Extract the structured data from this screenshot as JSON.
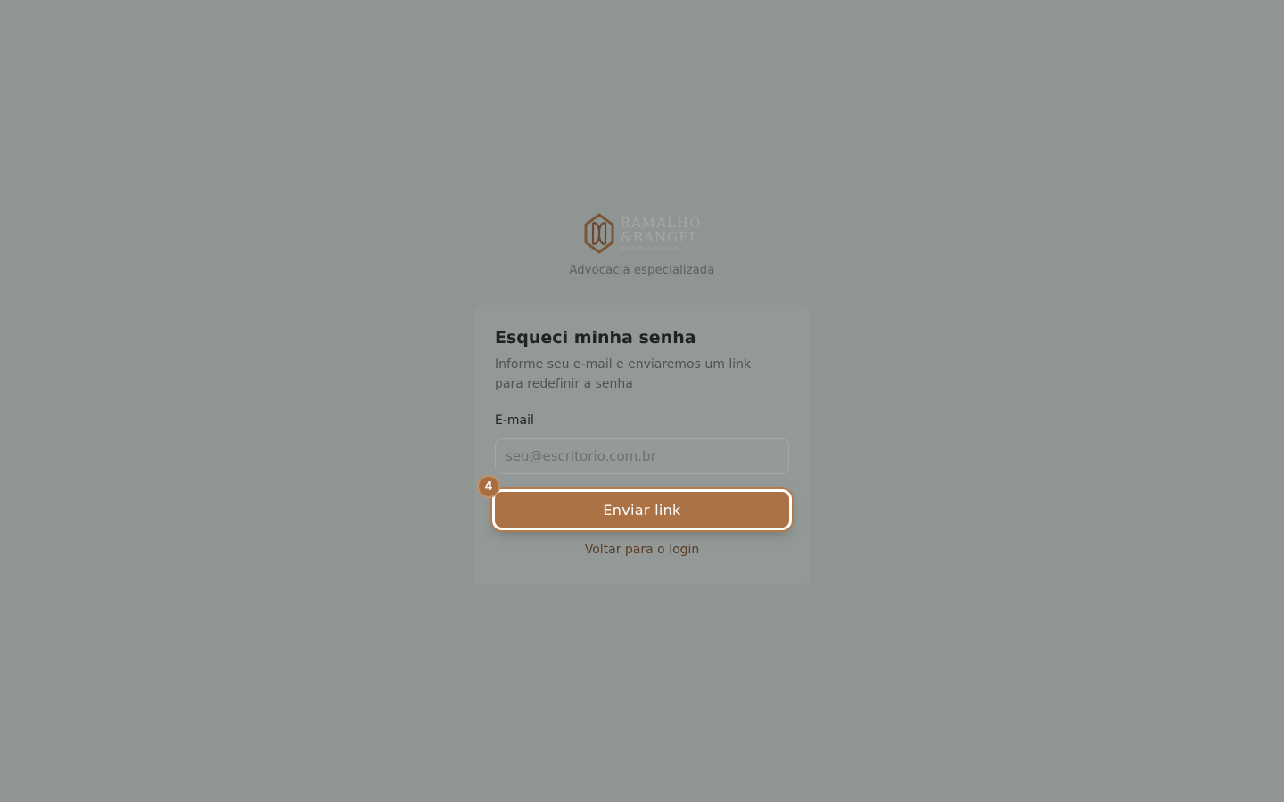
{
  "brand": {
    "logo_line1": "RAMALHO",
    "logo_line2": "&RANGEL",
    "logo_tagline": "SOCIEDADE DE ADVOGADOS",
    "subtitle": "Advocacia especializada"
  },
  "form": {
    "title": "Esqueci minha senha",
    "description": "Informe seu e-mail e enviaremos um link para redefinir a senha",
    "email_label": "E-mail",
    "email_placeholder": "seu@escritorio.com.br",
    "email_value": "",
    "submit_label": "Enviar link",
    "back_link": "Voltar para o login"
  },
  "annotation": {
    "step_number": "4"
  },
  "colors": {
    "background": "#8f9593",
    "card": "#939997",
    "accent": "#ab7245",
    "link": "#5a3b22"
  },
  "icons": {
    "logo": "law-firm-monogram-icon"
  }
}
